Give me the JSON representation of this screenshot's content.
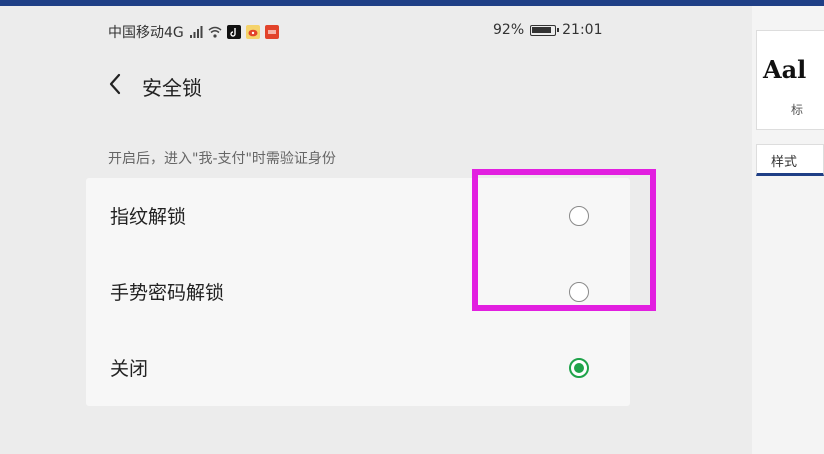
{
  "status_bar": {
    "carrier": "中国移动4G",
    "battery": "92%",
    "time": "21:01"
  },
  "header": {
    "title": "安全锁",
    "back_icon": "chevron-left-icon"
  },
  "hint": "开启后，进入\"我-支付\"时需验证身份",
  "options": [
    {
      "label": "指纹解锁",
      "selected": false
    },
    {
      "label": "手势密码解锁",
      "selected": false
    },
    {
      "label": "关闭",
      "selected": true
    }
  ],
  "colors": {
    "accent": "#1fa34a",
    "highlight": "#e21fe0",
    "top_bar": "#1f3f86"
  },
  "right_panel": {
    "preview": "Aal",
    "small_label": "标",
    "tab_label": "样式"
  }
}
